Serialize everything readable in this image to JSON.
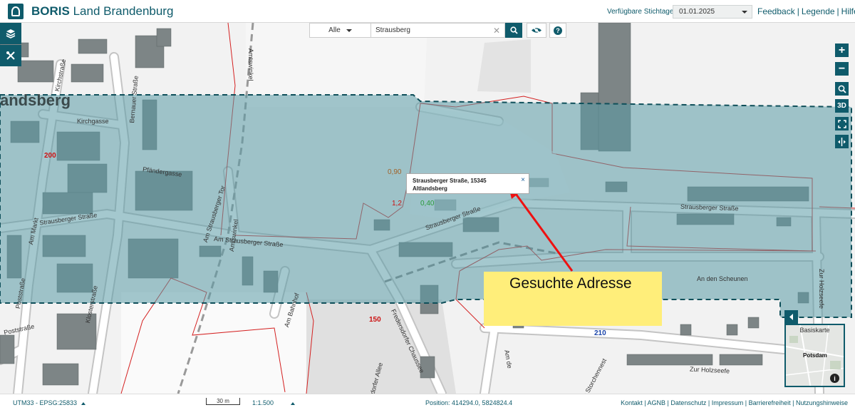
{
  "header": {
    "brand_bold": "BORIS",
    "brand_rest": "Land Brandenburg",
    "stichtag_label": "Verfügbare Stichtage:",
    "stichtag_value": "01.01.2025",
    "links": [
      "Feedback",
      "Legende",
      "Hilfe"
    ]
  },
  "search": {
    "filter": "Alle",
    "value": "Strausberg",
    "clear": "✕"
  },
  "right_tools": {
    "zoom_in": "+",
    "zoom_out": "−",
    "mode_3d": "3D"
  },
  "popup": {
    "line1": "Strausberger Straße, 15345",
    "line2": "Altlandsberg",
    "close": "×"
  },
  "annotation": {
    "text": "Gesuchte Adresse",
    "color": "#ffee7a",
    "arrow_color": "#ee1111"
  },
  "map": {
    "place_label": "andsberg",
    "street_labels": {
      "kirchgasse": "Kirchgasse",
      "kirchstrasse": "Kirchstraße",
      "bernauer": "Bernauer Straße",
      "pfandergasse": "Pfändergasse",
      "strausberger_tor": "Am Strausberger Tor",
      "strausberger_w": "Strausberger Straße",
      "strausberger_mid": "Am Strausberger Straße",
      "strausberger_e1": "Strausberger Straße",
      "strausberger_e2": "Strausberger Straße",
      "am_markt": "Am Markt",
      "poststrasse1": "Poststraße",
      "poststrasse2": "Poststraße",
      "klosterstrasse": "Klosterstraße",
      "amtswinkel1": "Amtswinkel",
      "amtswinkel2": "Amtswinkel",
      "am_bahnhof": "Am Bahnhof",
      "fredersdorfer": "Fredersdorfer Chaussee",
      "bollensdorfer": "Bollensdorfer Allee",
      "an_den_scheunen": "An den Scheunen",
      "zur_holzseefe1": "Zur Holzseefe",
      "zur_holzseefe2": "Zur Holzseefe",
      "storchennest": "Zur Storchennest",
      "am_de": "Am de"
    },
    "value_labels": {
      "v200": "200",
      "v150": "150",
      "v210": "210",
      "v090": "0,90",
      "v040": "0,40",
      "v12": "1,2"
    },
    "colors": {
      "overlay": "#5a9aa5",
      "overlay_border": "#0f4f5a",
      "parcel_red": "#d42020",
      "building": "#5f6e6f",
      "accent": "#0f5b6b",
      "value_red": "#cc1111",
      "value_blue": "#1a44aa",
      "value_green": "#2a9a3a",
      "value_brown": "#a0632a"
    }
  },
  "minimap": {
    "title": "Basiskarte",
    "city": "Potsdam",
    "info": "i"
  },
  "status": {
    "crs": "UTM33 - EPSG:25833",
    "scale_bar": "30 m",
    "scale": "1:1.500",
    "position": "Position: 414294.0, 5824824.4",
    "footer_links": "Kontakt | AGNB | Datenschutz | Impressum | Barrierefreiheit | Nutzungshinweise"
  }
}
